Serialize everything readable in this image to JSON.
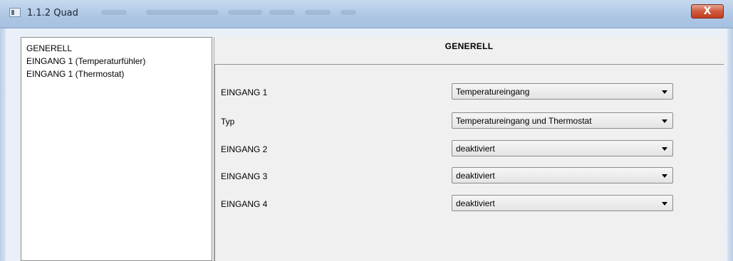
{
  "window": {
    "title": "1.1.2 Quad",
    "close_label": "X"
  },
  "nav": {
    "items": [
      {
        "label": "GENERELL"
      },
      {
        "label": "EINGANG 1 (Temperaturfühler)"
      },
      {
        "label": "EINGANG 1 (Thermostat)"
      }
    ]
  },
  "panel": {
    "title": "GENERELL",
    "rows": [
      {
        "label": "EINGANG 1",
        "value": "Temperatureingang"
      },
      {
        "label": "Typ",
        "value": "Temperatureingang und Thermostat"
      },
      {
        "label": "EINGANG 2",
        "value": "deaktiviert"
      },
      {
        "label": "EINGANG 3",
        "value": "deaktiviert"
      },
      {
        "label": "EINGANG 4",
        "value": "deaktiviert"
      }
    ]
  }
}
